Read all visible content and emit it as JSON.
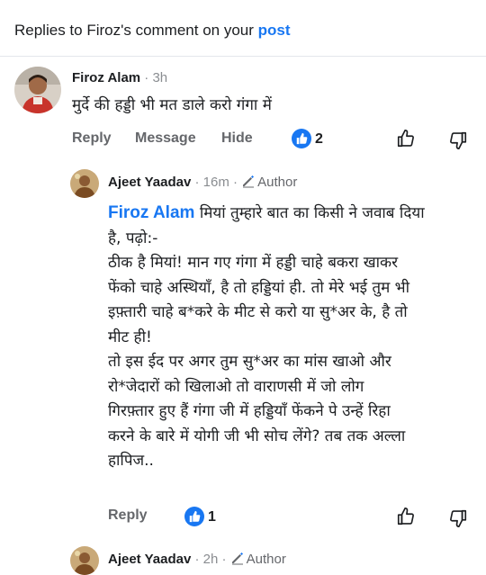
{
  "header": {
    "prefix": "Replies to Firoz's comment on your ",
    "link": "post"
  },
  "comments": [
    {
      "author": "Firoz Alam",
      "time": "· 3h",
      "text": "मुर्दे की हड्डी भी मत डाले करो गंगा में",
      "actions": {
        "reply": "Reply",
        "message": "Message",
        "hide": "Hide"
      },
      "likes": "2"
    },
    {
      "author": "Ajeet Yaadav",
      "time": "· 16m ·",
      "author_badge": "Author",
      "mention": "Firoz Alam",
      "text": " मियां तुम्हारे बात का किसी ने जवाब दिया\nहै, पढ़ो:-\nठीक है मियां! मान गए गंगा में हड्डी चाहे बकरा खाकर\nफेंको चाहे अस्थियाँ, है तो हड्डियां ही. तो मेरे भई तुम भी\nइफ़्तारी चाहे ब*करे के मीट से करो या सु*अर के, है तो\nमीट ही!\nतो इस ईद पर अगर तुम सु*अर का मांस खाओ और\nरो*जेदारों को खिलाओ तो वाराणसी में जो लोग\nगिरफ़्तार हुए हैं गंगा जी में हड्डियाँ फेंकने पे उन्हें रिहा\nकरने के बारे में योगी जी भी सोच लेंगे? तब तक अल्ला\nहापिज..",
      "actions": {
        "reply": "Reply"
      },
      "likes": "1"
    },
    {
      "author": "Ajeet Yaadav",
      "time": "· 2h ·",
      "author_badge": "Author"
    }
  ],
  "colors": {
    "accent": "#1877f2",
    "muted": "#65676b",
    "meta": "#8a8d91"
  }
}
